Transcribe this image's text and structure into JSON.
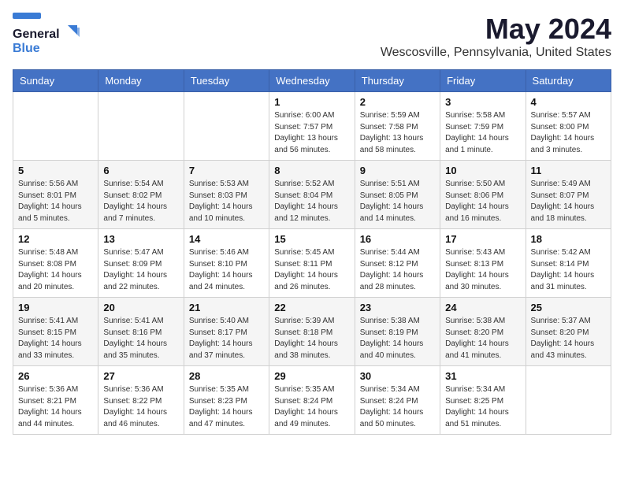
{
  "header": {
    "logo_line1": "General",
    "logo_line2": "Blue",
    "month_year": "May 2024",
    "location": "Wescosville, Pennsylvania, United States"
  },
  "weekdays": [
    "Sunday",
    "Monday",
    "Tuesday",
    "Wednesday",
    "Thursday",
    "Friday",
    "Saturday"
  ],
  "weeks": [
    [
      {
        "day": "",
        "info": ""
      },
      {
        "day": "",
        "info": ""
      },
      {
        "day": "",
        "info": ""
      },
      {
        "day": "1",
        "info": "Sunrise: 6:00 AM\nSunset: 7:57 PM\nDaylight: 13 hours\nand 56 minutes."
      },
      {
        "day": "2",
        "info": "Sunrise: 5:59 AM\nSunset: 7:58 PM\nDaylight: 13 hours\nand 58 minutes."
      },
      {
        "day": "3",
        "info": "Sunrise: 5:58 AM\nSunset: 7:59 PM\nDaylight: 14 hours\nand 1 minute."
      },
      {
        "day": "4",
        "info": "Sunrise: 5:57 AM\nSunset: 8:00 PM\nDaylight: 14 hours\nand 3 minutes."
      }
    ],
    [
      {
        "day": "5",
        "info": "Sunrise: 5:56 AM\nSunset: 8:01 PM\nDaylight: 14 hours\nand 5 minutes."
      },
      {
        "day": "6",
        "info": "Sunrise: 5:54 AM\nSunset: 8:02 PM\nDaylight: 14 hours\nand 7 minutes."
      },
      {
        "day": "7",
        "info": "Sunrise: 5:53 AM\nSunset: 8:03 PM\nDaylight: 14 hours\nand 10 minutes."
      },
      {
        "day": "8",
        "info": "Sunrise: 5:52 AM\nSunset: 8:04 PM\nDaylight: 14 hours\nand 12 minutes."
      },
      {
        "day": "9",
        "info": "Sunrise: 5:51 AM\nSunset: 8:05 PM\nDaylight: 14 hours\nand 14 minutes."
      },
      {
        "day": "10",
        "info": "Sunrise: 5:50 AM\nSunset: 8:06 PM\nDaylight: 14 hours\nand 16 minutes."
      },
      {
        "day": "11",
        "info": "Sunrise: 5:49 AM\nSunset: 8:07 PM\nDaylight: 14 hours\nand 18 minutes."
      }
    ],
    [
      {
        "day": "12",
        "info": "Sunrise: 5:48 AM\nSunset: 8:08 PM\nDaylight: 14 hours\nand 20 minutes."
      },
      {
        "day": "13",
        "info": "Sunrise: 5:47 AM\nSunset: 8:09 PM\nDaylight: 14 hours\nand 22 minutes."
      },
      {
        "day": "14",
        "info": "Sunrise: 5:46 AM\nSunset: 8:10 PM\nDaylight: 14 hours\nand 24 minutes."
      },
      {
        "day": "15",
        "info": "Sunrise: 5:45 AM\nSunset: 8:11 PM\nDaylight: 14 hours\nand 26 minutes."
      },
      {
        "day": "16",
        "info": "Sunrise: 5:44 AM\nSunset: 8:12 PM\nDaylight: 14 hours\nand 28 minutes."
      },
      {
        "day": "17",
        "info": "Sunrise: 5:43 AM\nSunset: 8:13 PM\nDaylight: 14 hours\nand 30 minutes."
      },
      {
        "day": "18",
        "info": "Sunrise: 5:42 AM\nSunset: 8:14 PM\nDaylight: 14 hours\nand 31 minutes."
      }
    ],
    [
      {
        "day": "19",
        "info": "Sunrise: 5:41 AM\nSunset: 8:15 PM\nDaylight: 14 hours\nand 33 minutes."
      },
      {
        "day": "20",
        "info": "Sunrise: 5:41 AM\nSunset: 8:16 PM\nDaylight: 14 hours\nand 35 minutes."
      },
      {
        "day": "21",
        "info": "Sunrise: 5:40 AM\nSunset: 8:17 PM\nDaylight: 14 hours\nand 37 minutes."
      },
      {
        "day": "22",
        "info": "Sunrise: 5:39 AM\nSunset: 8:18 PM\nDaylight: 14 hours\nand 38 minutes."
      },
      {
        "day": "23",
        "info": "Sunrise: 5:38 AM\nSunset: 8:19 PM\nDaylight: 14 hours\nand 40 minutes."
      },
      {
        "day": "24",
        "info": "Sunrise: 5:38 AM\nSunset: 8:20 PM\nDaylight: 14 hours\nand 41 minutes."
      },
      {
        "day": "25",
        "info": "Sunrise: 5:37 AM\nSunset: 8:20 PM\nDaylight: 14 hours\nand 43 minutes."
      }
    ],
    [
      {
        "day": "26",
        "info": "Sunrise: 5:36 AM\nSunset: 8:21 PM\nDaylight: 14 hours\nand 44 minutes."
      },
      {
        "day": "27",
        "info": "Sunrise: 5:36 AM\nSunset: 8:22 PM\nDaylight: 14 hours\nand 46 minutes."
      },
      {
        "day": "28",
        "info": "Sunrise: 5:35 AM\nSunset: 8:23 PM\nDaylight: 14 hours\nand 47 minutes."
      },
      {
        "day": "29",
        "info": "Sunrise: 5:35 AM\nSunset: 8:24 PM\nDaylight: 14 hours\nand 49 minutes."
      },
      {
        "day": "30",
        "info": "Sunrise: 5:34 AM\nSunset: 8:24 PM\nDaylight: 14 hours\nand 50 minutes."
      },
      {
        "day": "31",
        "info": "Sunrise: 5:34 AM\nSunset: 8:25 PM\nDaylight: 14 hours\nand 51 minutes."
      },
      {
        "day": "",
        "info": ""
      }
    ]
  ]
}
